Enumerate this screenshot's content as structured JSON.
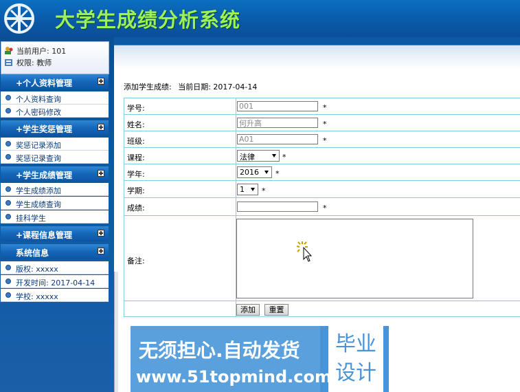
{
  "header": {
    "title": "大学生成绩分析系统",
    "colors": {
      "bar": "#0b5aa8",
      "title": "#9ef05a"
    }
  },
  "user": {
    "current_user": "当前用户: 101",
    "role": "权限: 教师"
  },
  "sidebar": {
    "sections": [
      {
        "title": "+个人资料管理",
        "items": [
          "个人资料查询",
          "个人密码修改"
        ]
      },
      {
        "title": "+学生奖惩管理",
        "items": [
          "奖惩记录添加",
          "奖惩记录查询"
        ]
      },
      {
        "title": "+学生成绩管理",
        "items": [
          "学生成绩添加",
          "学生成绩查询",
          "挂科学生"
        ]
      },
      {
        "title": "+课程信息管理",
        "items": []
      },
      {
        "title": "系统信息",
        "items": [
          "版权: xxxxx",
          "开发时间: 2017-04-14",
          "学校: xxxxx"
        ]
      }
    ]
  },
  "breadcrumb": {
    "label": "添加学生成绩:",
    "date": "当前日期: 2017-04-14"
  },
  "form": {
    "student_id": {
      "label": "学号:",
      "value": "001"
    },
    "name": {
      "label": "姓名:",
      "value": "何升高"
    },
    "class": {
      "label": "班级:",
      "value": "A01"
    },
    "course": {
      "label": "课程:",
      "value": "法律"
    },
    "year": {
      "label": "学年:",
      "value": "2016"
    },
    "term": {
      "label": "学期:",
      "value": "1"
    },
    "score": {
      "label": "成绩:",
      "value": ""
    },
    "remarks": {
      "label": "备注:"
    },
    "required_mark": "*",
    "add_button": "添加",
    "reset_button": "重置"
  },
  "watermark": {
    "line1": "无须担心.自动发货",
    "line2": "www.51topmind.com",
    "badge": "毕业设计"
  }
}
